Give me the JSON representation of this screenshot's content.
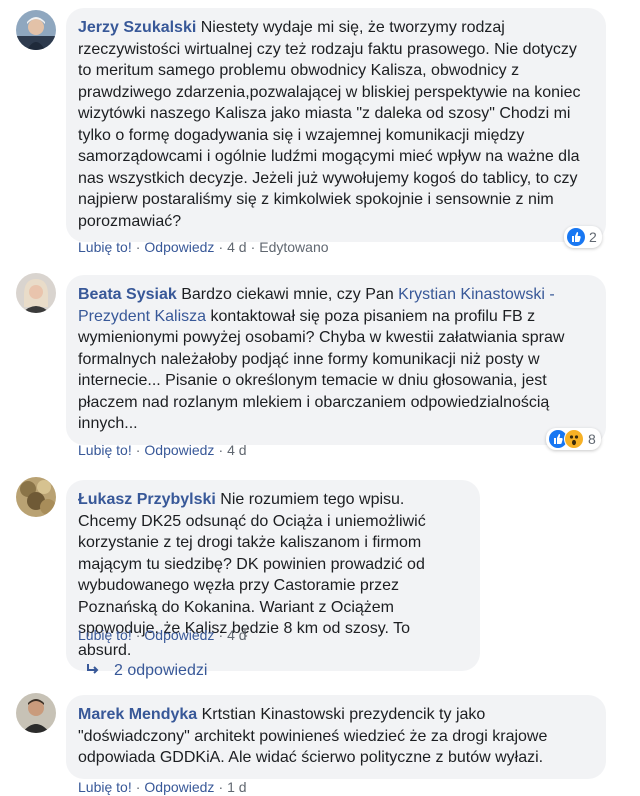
{
  "comments": [
    {
      "author": "Jerzy Szukalski",
      "text": "Niestety wydaje mi się, że tworzymy rodzaj rzeczywistości wirtualnej czy też rodzaju faktu prasowego. Nie dotyczy to meritum samego problemu obwodnicy Kalisza, obwodnicy z prawdziwego zdarzenia,pozwalającej w bliskiej perspektywie na koniec wizytówki naszego Kalisza jako miasta \"z daleka od szosy\" Chodzi mi tylko o formę dogadywania się i wzajemnej komunikacji między samorządowcami i ogólnie ludźmi mogącymi mieć wpływ na ważne dla nas wszystkich decyzje. Jeżeli już wywołujemy kogoś do tablicy, to czy najpierw postaraliśmy się z kimkolwiek spokojnie i sensownie z nim porozmawiać?",
      "like": "Lubię to!",
      "reply": "Odpowiedz",
      "time": "4 d",
      "edited": "Edytowano",
      "reaction_count": "2"
    },
    {
      "author": "Beata Sysiak",
      "text_before": "Bardzo ciekawi mnie, czy Pan",
      "tag": "Krystian Kinastowski - Prezydent Kalisza",
      "text_after": "kontaktował się poza pisaniem na profilu FB z wymienionymi powyżej osobami? Chyba w kwestii załatwiania spraw formalnych należałoby podjąć inne formy komunikacji niż posty w internecie... Pisanie o określonym temacie w dniu głosowania, jest płaczem nad rozlanym mlekiem i obarczaniem odpowiedzialnością innych...",
      "like": "Lubię to!",
      "reply": "Odpowiedz",
      "time": "4 d",
      "reaction_count": "8"
    },
    {
      "author": "Łukasz Przybylski",
      "text": "Nie rozumiem tego wpisu. Chcemy DK25 odsunąć do Ociąża i uniemożliwić korzystanie z tej drogi także kaliszanom i firmom mającym tu siedzibę? DK powinien prowadzić od wybudowanego węzła przy Castoramie przez Poznańską do Kokanina. Wariant z Ociążem spowoduje, że Kalisz będzie 8 km od szosy. To absurd.",
      "like": "Lubię to!",
      "reply": "Odpowiedz",
      "time": "4 d"
    },
    {
      "author": "Marek Mendyka",
      "text": "Krtstian Kinastowski prezydencik ty jako \"doświadczony\" architekt powinieneś wiedzieć że za drogi krajowe odpowiada GDDKiA. Ale widać ścierwo polityczne z butów wyłazi.",
      "like": "Lubię to!",
      "reply": "Odpowiedz",
      "time": "1 d"
    }
  ],
  "replies_link": "2 odpowiedzi",
  "colors": {
    "link": "#385898",
    "bubble": "#f2f3f5",
    "meta": "#606770"
  },
  "icons": [
    "like-reaction-icon",
    "wow-reaction-icon",
    "reply-arrow-icon"
  ]
}
